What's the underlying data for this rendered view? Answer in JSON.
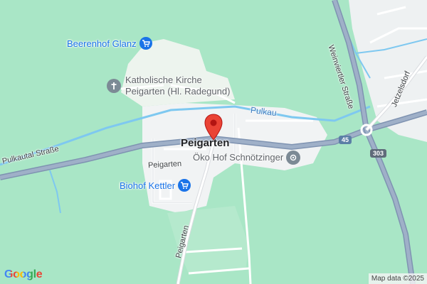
{
  "map": {
    "town": "Peigarten",
    "pois": [
      {
        "label": "Beerenhof Glanz",
        "icon": "shopping-cart-icon"
      },
      {
        "label_line1": "Katholische Kirche",
        "label_line2": "Peigarten (Hl. Radegund)",
        "icon": "church-cross-icon"
      },
      {
        "label": "Öko Hof Schnötzinger",
        "icon": "place-pin-icon"
      },
      {
        "label": "Biohof Kettler",
        "icon": "shopping-cart-icon"
      }
    ],
    "roads": {
      "main": "Pulkautal Straße",
      "weinviertler": "Weinviertler Straße",
      "jetzelsdorf": "Jetzelsdorf",
      "peigarten_1": "Peigarten",
      "peigarten_2": "Peigarten"
    },
    "water": "Pulkau",
    "shields": {
      "route_45": "45",
      "route_303": "303"
    },
    "colors": {
      "land": "#a9e6c6",
      "settlement": "#f1f3f4",
      "road_main": "#8ea2bf",
      "water": "#7ec8f0",
      "marker": "#ea4335",
      "poi_blue": "#1a73e8",
      "poi_grey": "#5f6368"
    }
  },
  "branding": {
    "logo": "Google",
    "attribution": "Map data ©2025"
  }
}
